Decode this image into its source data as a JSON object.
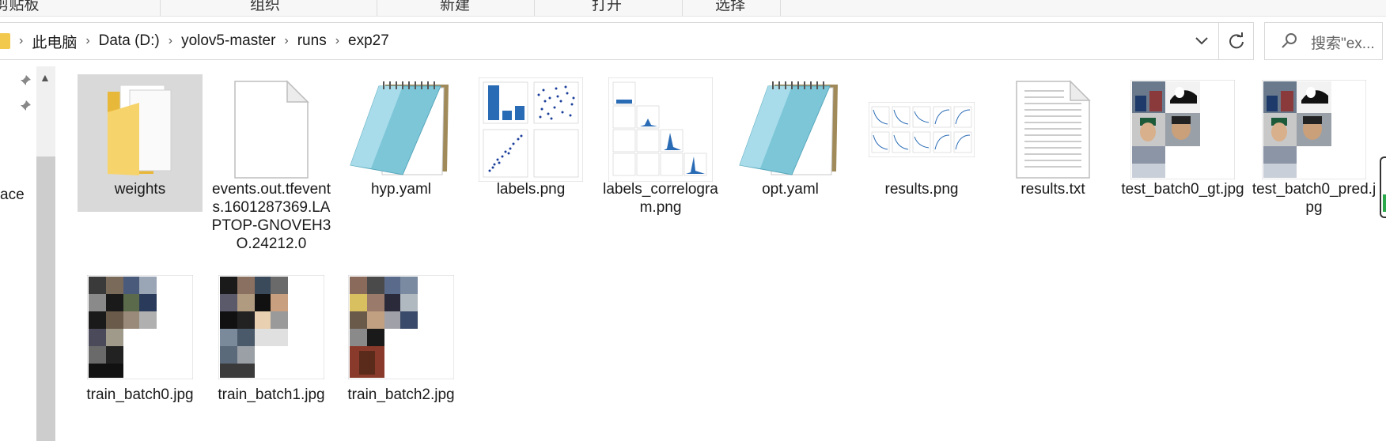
{
  "ribbon": {
    "groups": [
      "剪贴板",
      "组织",
      "新建",
      "打开",
      "选择"
    ]
  },
  "address": {
    "path": [
      "此电脑",
      "Data (D:)",
      "yolov5-master",
      "runs",
      "exp27"
    ],
    "search_placeholder": "搜索\"ex..."
  },
  "nav": {
    "partial_label": "ace"
  },
  "files": [
    {
      "name": "weights",
      "kind": "folder",
      "selected": true
    },
    {
      "name": "events.out.tfevents.1601287369.LAPTOP-GNOVEH3O.24212.0",
      "kind": "blank"
    },
    {
      "name": "hyp.yaml",
      "kind": "notepad"
    },
    {
      "name": "labels.png",
      "kind": "labels"
    },
    {
      "name": "labels_correlogram.png",
      "kind": "correlogram"
    },
    {
      "name": "opt.yaml",
      "kind": "notepad"
    },
    {
      "name": "results.png",
      "kind": "results"
    },
    {
      "name": "results.txt",
      "kind": "text"
    },
    {
      "name": "test_batch0_gt.jpg",
      "kind": "test"
    },
    {
      "name": "test_batch0_pred.jpg",
      "kind": "test"
    },
    {
      "name": "train_batch0.jpg",
      "kind": "train"
    },
    {
      "name": "train_batch1.jpg",
      "kind": "train"
    },
    {
      "name": "train_batch2.jpg",
      "kind": "train"
    }
  ],
  "colors": {
    "selection": "#d9d9d9",
    "folder": "#f2c94c",
    "notepad": "#7cc6d8",
    "chart_blue": "#2a6bb5"
  }
}
